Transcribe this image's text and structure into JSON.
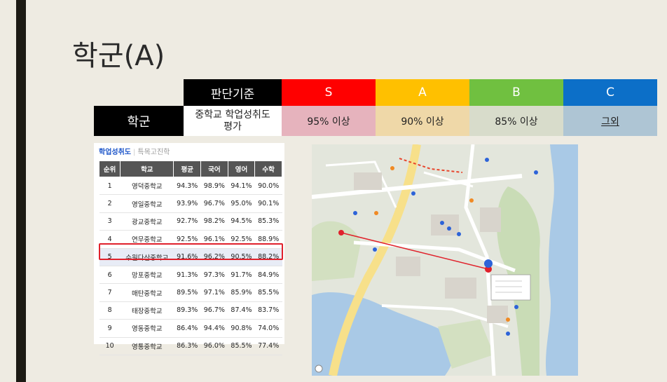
{
  "slide": {
    "title": "학군(A)"
  },
  "criteria": {
    "header": {
      "basis": "판단기준",
      "grades": [
        "S",
        "A",
        "B",
        "C"
      ]
    },
    "row": {
      "label": "학군",
      "basis_text": "중학교 학업성취도\n평가",
      "thresholds": [
        "95% 이상",
        "90% 이상",
        "85% 이상",
        "그외"
      ]
    },
    "colors": {
      "S": "#ff0000",
      "A": "#ffc000",
      "B": "#70c040",
      "C": "#0c6fc8",
      "S_row": "#e6b3bd",
      "A_row": "#efd8a8",
      "B_row": "#d8dccb",
      "C_row": "#aec5d4"
    }
  },
  "score_panel": {
    "tabs": [
      "학업성취도",
      "특목고진학"
    ],
    "columns": [
      "순위",
      "학교",
      "평균",
      "국어",
      "영어",
      "수학"
    ],
    "highlight_row": 5,
    "rows": [
      [
        "1",
        "영덕중학교",
        "94.3%",
        "98.9%",
        "94.1%",
        "90.0%"
      ],
      [
        "2",
        "영일중학교",
        "93.9%",
        "96.7%",
        "95.0%",
        "90.1%"
      ],
      [
        "3",
        "광교중학교",
        "92.7%",
        "98.2%",
        "94.5%",
        "85.3%"
      ],
      [
        "4",
        "연무중학교",
        "92.5%",
        "96.1%",
        "92.5%",
        "88.9%"
      ],
      [
        "5",
        "수원다산중학교",
        "91.6%",
        "96.2%",
        "90.5%",
        "88.2%"
      ],
      [
        "6",
        "망포중학교",
        "91.3%",
        "97.3%",
        "91.7%",
        "84.9%"
      ],
      [
        "7",
        "매탄중학교",
        "89.5%",
        "97.1%",
        "85.9%",
        "85.5%"
      ],
      [
        "8",
        "태장중학교",
        "89.3%",
        "96.7%",
        "87.4%",
        "83.7%"
      ],
      [
        "9",
        "영동중학교",
        "86.4%",
        "94.4%",
        "90.8%",
        "74.0%"
      ],
      [
        "10",
        "영통중학교",
        "86.3%",
        "96.0%",
        "85.5%",
        "77.4%"
      ]
    ]
  }
}
